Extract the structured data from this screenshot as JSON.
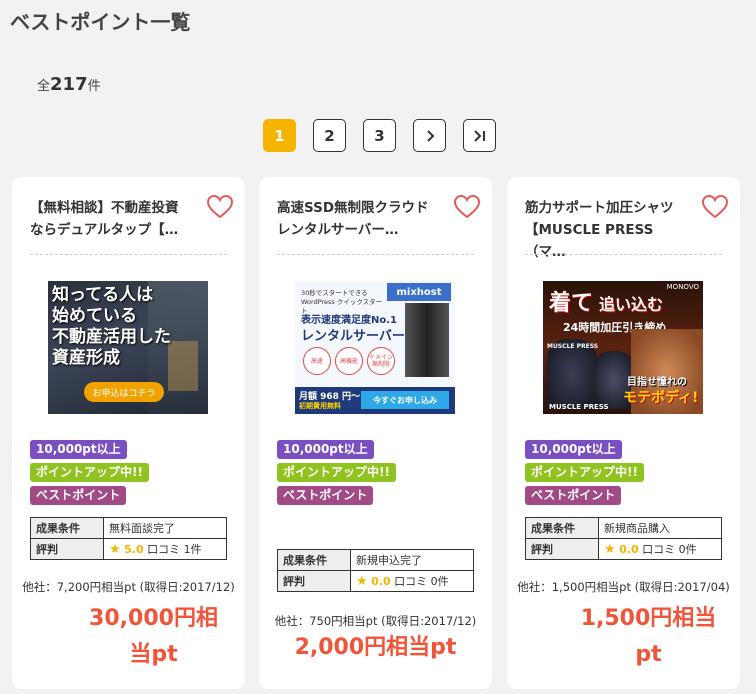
{
  "page": {
    "title": "ベストポイント一覧",
    "total_prefix": "全",
    "total_count": "217",
    "total_suffix": "件"
  },
  "pagination": {
    "pages": [
      "1",
      "2",
      "3"
    ],
    "next": "›",
    "last": "›|"
  },
  "colors": {
    "accent": "#f5b400",
    "price": "#f0553a",
    "badge_pt": "#7a4fc1",
    "badge_up": "#8fc31f",
    "badge_best": "#a14a86"
  },
  "cards": [
    {
      "title": "【無料相談】不動産投資\nならデュアルタップ【…",
      "banner": {
        "lines": [
          "知ってる人は",
          "始めている",
          "不動産活用した",
          "資産形成"
        ],
        "button": "お申込はコチラ"
      },
      "badges": [
        "10,000pt以上",
        "ポイントアップ中!!",
        "ベストポイント"
      ],
      "cond_label": "成果条件",
      "cond_value": "無料面談完了",
      "rating_label": "評判",
      "score": "5.0",
      "review_label": "口コミ",
      "review_count": "1件",
      "other": "他社：7,200円相当pt (取得日:2017/12)",
      "price": "30,000円相当pt"
    },
    {
      "title": "高速SSD無制限クラウド\nレンタルサーバー…",
      "banner": {
        "brand": "mixhost",
        "small": "30秒でスタートできる WordPress クイックスタート",
        "line1": "表示速度満足度No.1",
        "line2": "レンタルサーバー",
        "circles": [
          "高速",
          "高機能",
          "ドメイン無制限"
        ],
        "price": "月額 968 円〜",
        "price_sub": "初期費用無料",
        "button": "今すぐお申し込み"
      },
      "badges": [
        "10,000pt以上",
        "ポイントアップ中!!",
        "ベストポイント"
      ],
      "cond_label": "成果条件",
      "cond_value": "新規申込完了",
      "rating_label": "評判",
      "score": "0.0",
      "review_label": "口コミ",
      "review_count": "0件",
      "other": "他社：750円相当pt (取得日:2017/12)",
      "price": "2,000円相当pt"
    },
    {
      "title": "筋力サポート加圧シャツ\n【MUSCLE PRESS（マ…",
      "banner": {
        "brand": "MONOVO",
        "head1": "着て",
        "head2": "追い込む",
        "sub": "24時間加圧引き締め",
        "tag": "MUSCLE PRESS",
        "slogan1": "目指せ憧れの",
        "slogan2": "モテボディ!",
        "tag2": "MUSCLE PRESS"
      },
      "badges": [
        "10,000pt以上",
        "ポイントアップ中!!",
        "ベストポイント"
      ],
      "cond_label": "成果条件",
      "cond_value": "新規商品購入",
      "rating_label": "評判",
      "score": "0.0",
      "review_label": "口コミ",
      "review_count": "0件",
      "other": "他社：1,500円相当pt (取得日:2017/04)",
      "price": "1,500円相当pt"
    }
  ]
}
